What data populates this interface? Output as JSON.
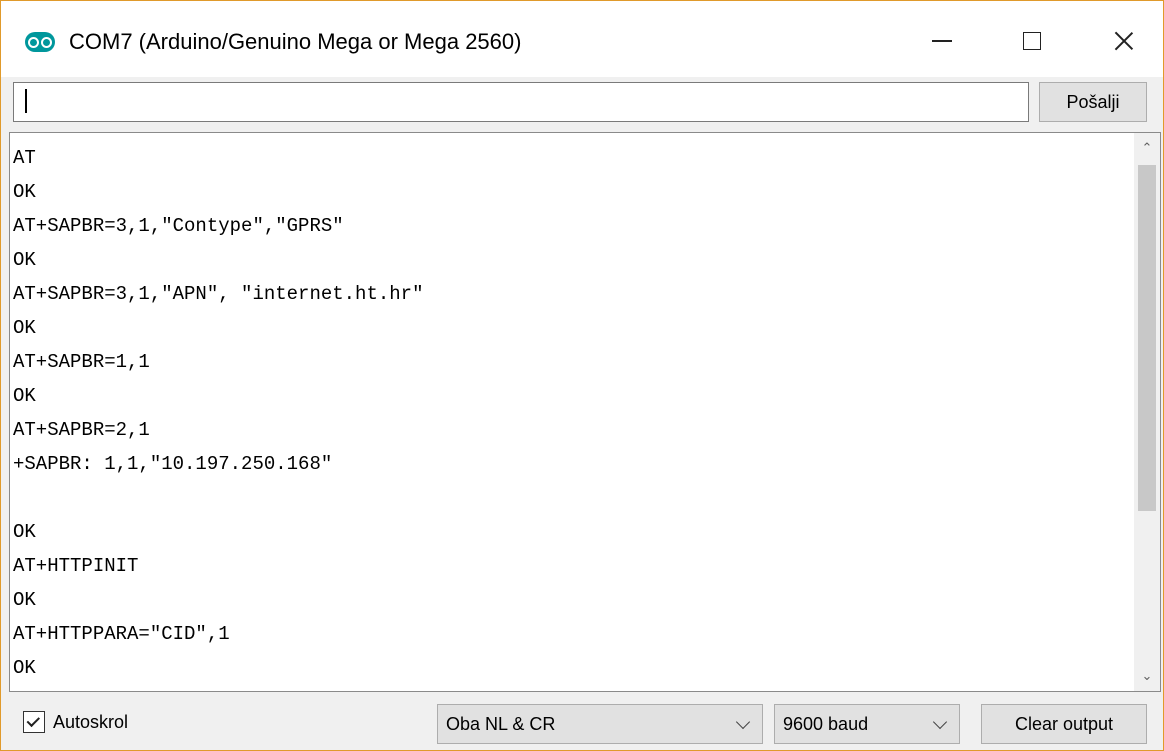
{
  "window": {
    "title": "COM7 (Arduino/Genuino Mega or Mega 2560)",
    "app_icon": "arduino-logo-icon",
    "controls": [
      "minimize-icon",
      "maximize-icon",
      "close-icon"
    ]
  },
  "send": {
    "input_value": "",
    "button_label": "Pošalji"
  },
  "output": {
    "lines": [
      "AT",
      "OK",
      "AT+SAPBR=3,1,\"Contype\",\"GPRS\"",
      "OK",
      "AT+SAPBR=3,1,\"APN\", \"internet.ht.hr\"",
      "OK",
      "AT+SAPBR=1,1",
      "OK",
      "AT+SAPBR=2,1",
      "+SAPBR: 1,1,\"10.197.250.168\"",
      "",
      "OK",
      "AT+HTTPINIT",
      "OK",
      "AT+HTTPPARA=\"CID\",1",
      "OK"
    ]
  },
  "footer": {
    "autoscroll_label": "Autoskrol",
    "autoscroll_checked": true,
    "line_ending_selected": "Oba NL & CR",
    "baud_selected": "9600 baud",
    "clear_label": "Clear output"
  },
  "colors": {
    "window_border": "#e09a2b",
    "app_icon": "#00979c"
  }
}
